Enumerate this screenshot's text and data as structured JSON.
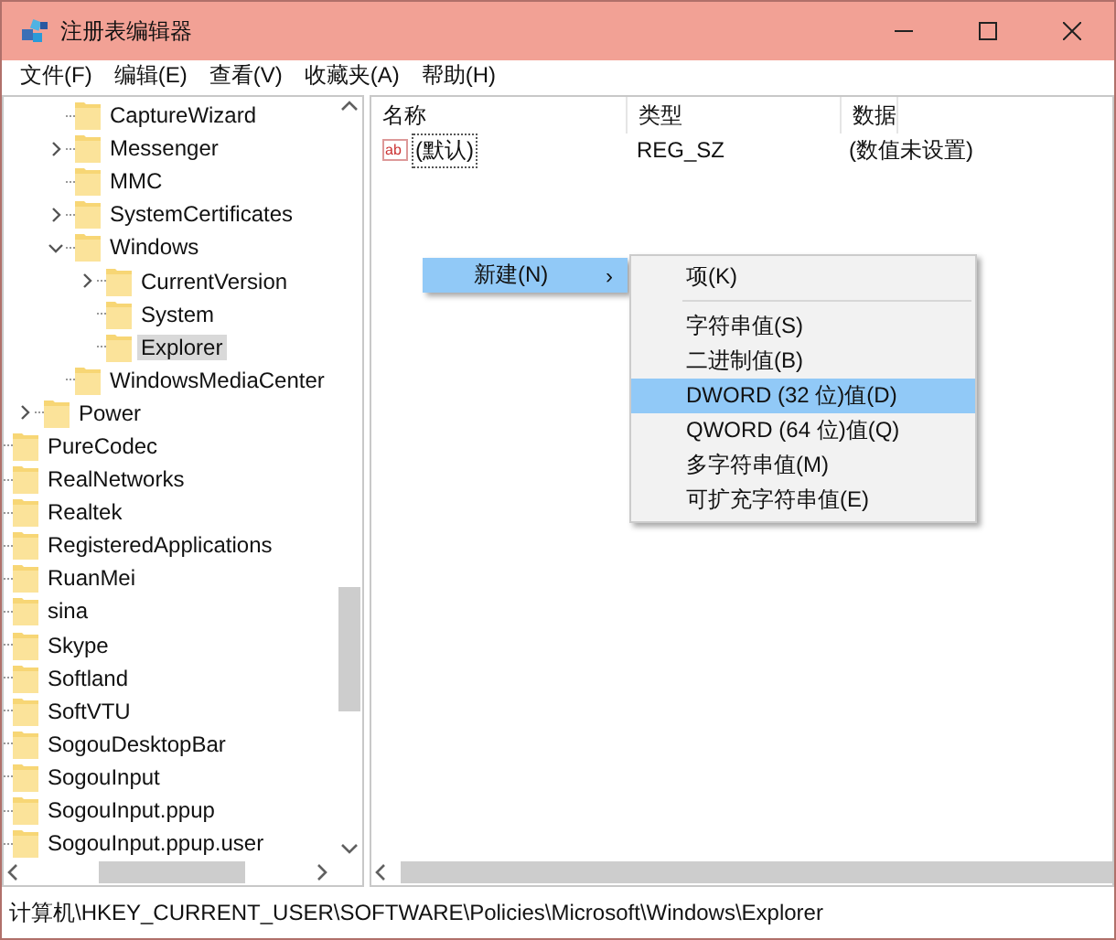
{
  "window": {
    "title": "注册表编辑器"
  },
  "menu_bar": [
    "文件(F)",
    "编辑(E)",
    "查看(V)",
    "收藏夹(A)",
    "帮助(H)"
  ],
  "tree": {
    "items": [
      {
        "children": [
          {
            "children": [
              {
                "label": "CaptureWizard",
                "selected": false
              },
              {
                "label": "Messenger",
                "selected": false,
                "expanded": false
              },
              {
                "label": "MMC",
                "selected": false
              },
              {
                "label": "SystemCertificates",
                "selected": false,
                "expanded": false
              },
              {
                "label": "Windows",
                "selected": false,
                "expanded": true,
                "children": [
                  {
                    "label": "CurrentVersion",
                    "selected": false,
                    "expanded": false
                  },
                  {
                    "label": "System",
                    "selected": false
                  },
                  {
                    "label": "Explorer",
                    "selected": true
                  }
                ]
              },
              {
                "label": "WindowsMediaCenter",
                "selected": false
              }
            ]
          },
          {
            "label": "Power",
            "selected": false,
            "expanded": false
          }
        ]
      },
      {
        "label": "PureCodec",
        "selected": false
      },
      {
        "label": "RealNetworks",
        "selected": false
      },
      {
        "label": "Realtek",
        "selected": false
      },
      {
        "label": "RegisteredApplications",
        "selected": false
      },
      {
        "label": "RuanMei",
        "selected": false
      },
      {
        "label": "sina",
        "selected": false
      },
      {
        "label": "Skype",
        "selected": false
      },
      {
        "label": "Softland",
        "selected": false
      },
      {
        "label": "SoftVTU",
        "selected": false
      },
      {
        "label": "SogouDesktopBar",
        "selected": false
      },
      {
        "label": "SogouInput",
        "selected": false
      },
      {
        "label": "SogouInput.ppup",
        "selected": false
      },
      {
        "label": "SogouInput.ppup.user",
        "selected": false
      }
    ]
  },
  "values_list": {
    "columns": [
      "名称",
      "类型",
      "数据"
    ],
    "rows": [
      {
        "icon": "ab",
        "name": "(默认)",
        "type": "REG_SZ",
        "data": "(数值未设置)"
      }
    ]
  },
  "context_menu": {
    "items": [
      {
        "label": "新建(N)",
        "arrow": "›",
        "selected": true
      }
    ]
  },
  "submenu": {
    "items": [
      {
        "kind": "item",
        "label": "项(K)",
        "selected": false
      },
      {
        "kind": "separator"
      },
      {
        "kind": "item",
        "label": "字符串值(S)",
        "selected": false
      },
      {
        "kind": "item",
        "label": "二进制值(B)",
        "selected": false
      },
      {
        "kind": "item",
        "label": "DWORD (32 位)值(D)",
        "selected": true
      },
      {
        "kind": "item",
        "label": "QWORD (64 位)值(Q)",
        "selected": false
      },
      {
        "kind": "item",
        "label": "多字符串值(M)",
        "selected": false
      },
      {
        "kind": "item",
        "label": "可扩充字符串值(E)",
        "selected": false
      }
    ]
  },
  "status_bar": {
    "path": "计算机\\HKEY_CURRENT_USER\\SOFTWARE\\Policies\\Microsoft\\Windows\\Explorer"
  }
}
